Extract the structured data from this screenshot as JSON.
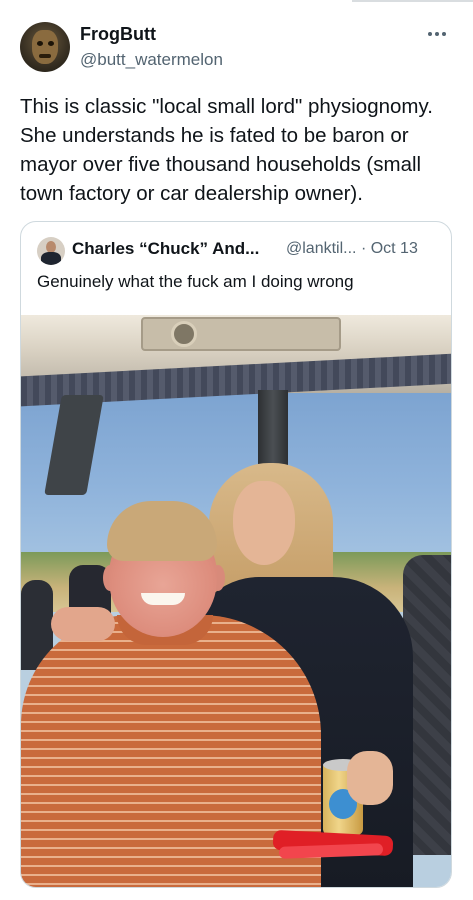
{
  "tweet": {
    "author_name": "FrogButt",
    "author_handle": "@butt_watermelon",
    "text": "This is classic \"local small lord\" physiognomy.\nShe understands he is fated to be baron or\nmayor over five thousand households (small\ntown factory or car dealership owner)."
  },
  "quoted_tweet": {
    "author_name": "Charles “Chuck” And...",
    "author_handle": "@lanktil...",
    "date": "· Oct 13",
    "text": "Genuinely what the fuck am I doing wrong"
  },
  "icons": {
    "more": "more-horizontal-icon",
    "avatar": "user-avatar",
    "quoted_avatar": "quoted-user-avatar"
  },
  "colors": {
    "text_primary": "#0f1419",
    "text_secondary": "#536471",
    "card_border": "#cfd9de"
  }
}
